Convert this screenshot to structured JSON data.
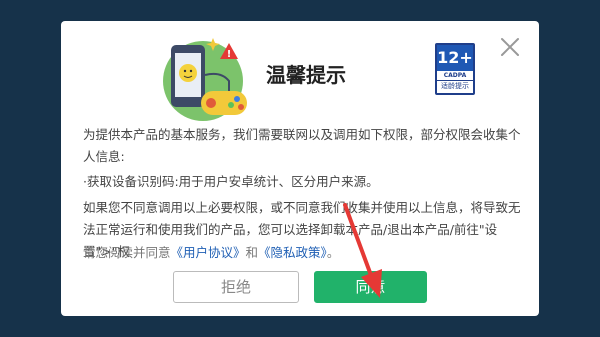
{
  "dialog": {
    "title": "温馨提示",
    "rating": {
      "age": "12+",
      "org": "CADPA",
      "tip": "适龄提示"
    },
    "paragraphs": [
      "为提供本产品的基本服务，我们需要联网以及调用如下权限，部分权限会收集个人信息:",
      "·获取设备识别码:用于用户安卓统计、区分用户来源。",
      "如果您不同意调用以上必要权限，或不同意我们收集并使用以上信息，将导致无法正常运行和使用我们的产品，您可以选择卸载本产品/退出本产品/前往\"设置\">\"权"
    ],
    "consent": {
      "prefix": "请您阅读并同意",
      "user_agreement": "《用户协议》",
      "and": "和",
      "privacy_policy": "《隐私政策》",
      "suffix": "。"
    },
    "reject_label": "拒绝",
    "agree_label": "同意"
  },
  "colors": {
    "background": "#16324a",
    "agree_button": "#21b26a",
    "link": "#1f5fb4",
    "annotation_arrow": "#e53935"
  },
  "icons": [
    "close-icon",
    "game-phone-illustration",
    "age-rating-badge",
    "warning-icon"
  ]
}
